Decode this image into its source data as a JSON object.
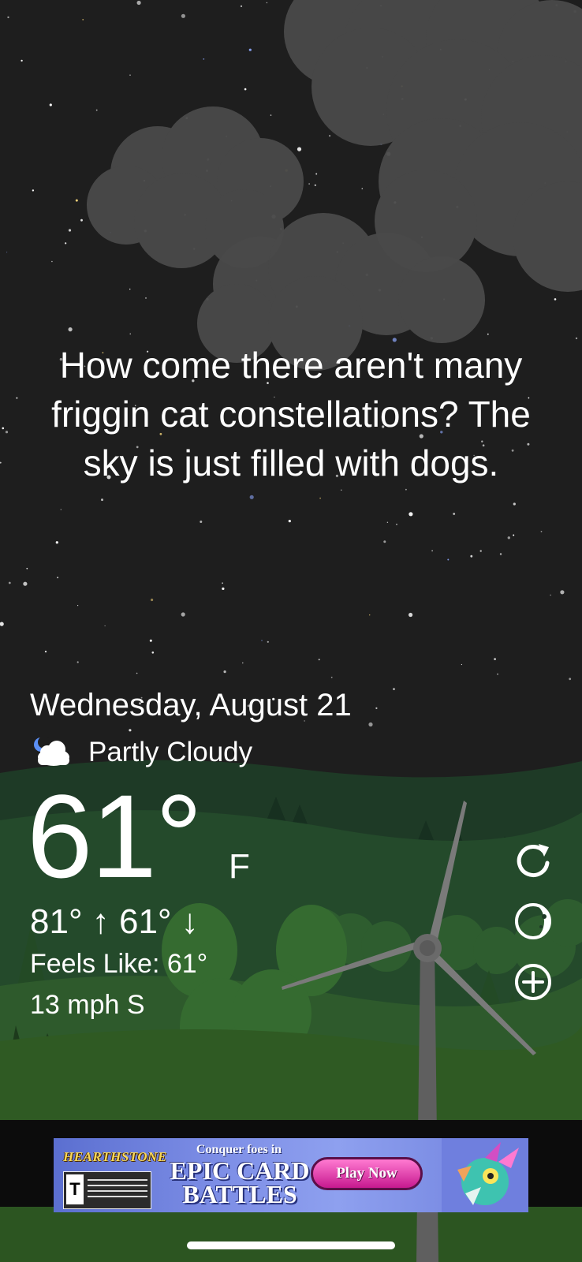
{
  "quote": {
    "text": "How come there aren't many friggin cat constellations? The sky is just filled with dogs."
  },
  "weather": {
    "date": "Wednesday, August 21",
    "condition": "Partly Cloudy",
    "condition_icon": "partly-cloudy-night-icon",
    "temperature": "61°",
    "unit": "F",
    "high_low": "81° ↑ 61° ↓",
    "feels_like": "Feels Like: 61°",
    "wind": "13 mph S"
  },
  "actions": {
    "refresh_icon": "refresh-icon",
    "moon_phase_icon": "moon-phase-icon",
    "add_icon": "add-circle-icon"
  },
  "ad": {
    "brand": "HEARTHSTONE",
    "rating": "T",
    "tagline": "Conquer foes in",
    "headline": "EPIC CARD BATTLES",
    "cta": "Play Now"
  },
  "colors": {
    "sky": "#1e1e1e",
    "cloud": "#4a4a4a",
    "hills_dark": "#1e3a26",
    "hills_mid": "#2b5430",
    "grass": "#2f5a23",
    "ad_pink": "#e03fb1",
    "text": "#ffffff"
  }
}
